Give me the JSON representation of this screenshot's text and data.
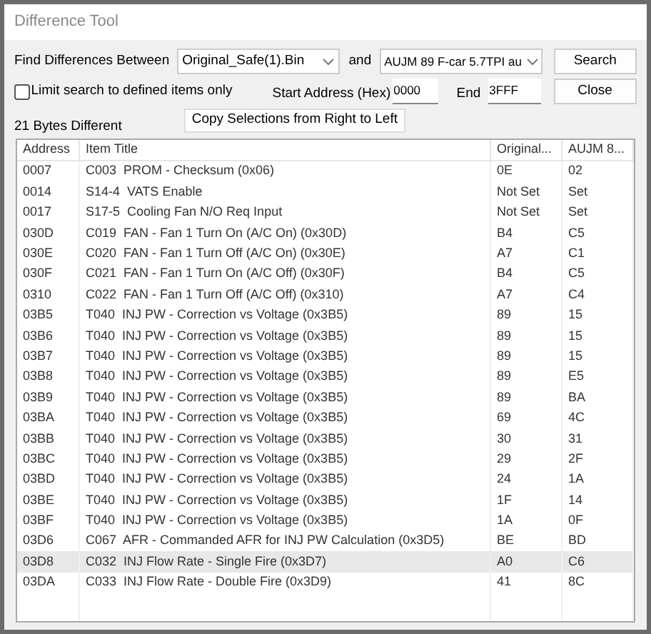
{
  "window": {
    "title": "Difference Tool"
  },
  "find": {
    "label": "Find Differences Between",
    "file_a": "Original_Safe(1).Bin",
    "and_label": "and",
    "file_b": "AUJM 89 F-car 5.7TPI au"
  },
  "buttons": [
    {
      "label": "Search"
    },
    {
      "label": "Close"
    }
  ],
  "limit": {
    "label": "Limit search to defined items only",
    "checked": false
  },
  "start": {
    "label": "Start Address (Hex)",
    "value": "0000"
  },
  "end": {
    "label": "End",
    "value": "3FFF"
  },
  "copy_button": "Copy Selections from Right to Left",
  "count": "21 Bytes Different",
  "table": {
    "columns": [
      "Address",
      "Item Title",
      "Original...",
      "AUJM 8..."
    ],
    "rows": [
      {
        "cells": [
          "0007",
          "C003  PROM - Checksum (0x06)",
          "0E",
          "02"
        ],
        "selected": false
      },
      {
        "cells": [
          "0014",
          "S14-4  VATS Enable",
          "Not Set",
          "Set"
        ],
        "selected": false
      },
      {
        "cells": [
          "0017",
          "S17-5  Cooling Fan N/O Req Input",
          "Not Set",
          "Set"
        ],
        "selected": false
      },
      {
        "cells": [
          "030D",
          "C019  FAN - Fan 1 Turn On (A/C On) (0x30D)",
          "B4",
          "C5"
        ],
        "selected": false
      },
      {
        "cells": [
          "030E",
          "C020  FAN - Fan 1 Turn Off (A/C On) (0x30E)",
          "A7",
          "C1"
        ],
        "selected": false
      },
      {
        "cells": [
          "030F",
          "C021  FAN - Fan 1 Turn On (A/C Off) (0x30F)",
          "B4",
          "C5"
        ],
        "selected": false
      },
      {
        "cells": [
          "0310",
          "C022  FAN - Fan 1 Turn Off (A/C Off) (0x310)",
          "A7",
          "C4"
        ],
        "selected": false
      },
      {
        "cells": [
          "03B5",
          "T040  INJ PW - Correction vs Voltage (0x3B5)",
          "89",
          "15"
        ],
        "selected": false
      },
      {
        "cells": [
          "03B6",
          "T040  INJ PW - Correction vs Voltage (0x3B5)",
          "89",
          "15"
        ],
        "selected": false
      },
      {
        "cells": [
          "03B7",
          "T040  INJ PW - Correction vs Voltage (0x3B5)",
          "89",
          "15"
        ],
        "selected": false
      },
      {
        "cells": [
          "03B8",
          "T040  INJ PW - Correction vs Voltage (0x3B5)",
          "89",
          "E5"
        ],
        "selected": false
      },
      {
        "cells": [
          "03B9",
          "T040  INJ PW - Correction vs Voltage (0x3B5)",
          "89",
          "BA"
        ],
        "selected": false
      },
      {
        "cells": [
          "03BA",
          "T040  INJ PW - Correction vs Voltage (0x3B5)",
          "69",
          "4C"
        ],
        "selected": false
      },
      {
        "cells": [
          "03BB",
          "T040  INJ PW - Correction vs Voltage (0x3B5)",
          "30",
          "31"
        ],
        "selected": false
      },
      {
        "cells": [
          "03BC",
          "T040  INJ PW - Correction vs Voltage (0x3B5)",
          "29",
          "2F"
        ],
        "selected": false
      },
      {
        "cells": [
          "03BD",
          "T040  INJ PW - Correction vs Voltage (0x3B5)",
          "24",
          "1A"
        ],
        "selected": false
      },
      {
        "cells": [
          "03BE",
          "T040  INJ PW - Correction vs Voltage (0x3B5)",
          "1F",
          "14"
        ],
        "selected": false
      },
      {
        "cells": [
          "03BF",
          "T040  INJ PW - Correction vs Voltage (0x3B5)",
          "1A",
          "0F"
        ],
        "selected": false
      },
      {
        "cells": [
          "03D6",
          "C067  AFR - Commanded AFR for INJ PW Calculation (0x3D5)",
          "BE",
          "BD"
        ],
        "selected": false
      },
      {
        "cells": [
          "03D8",
          "C032  INJ Flow Rate - Single Fire (0x3D7)",
          "A0",
          "C6"
        ],
        "selected": true
      },
      {
        "cells": [
          "03DA",
          "C033  INJ Flow Rate - Double Fire (0x3D9)",
          "41",
          "8C"
        ],
        "selected": false
      }
    ]
  }
}
